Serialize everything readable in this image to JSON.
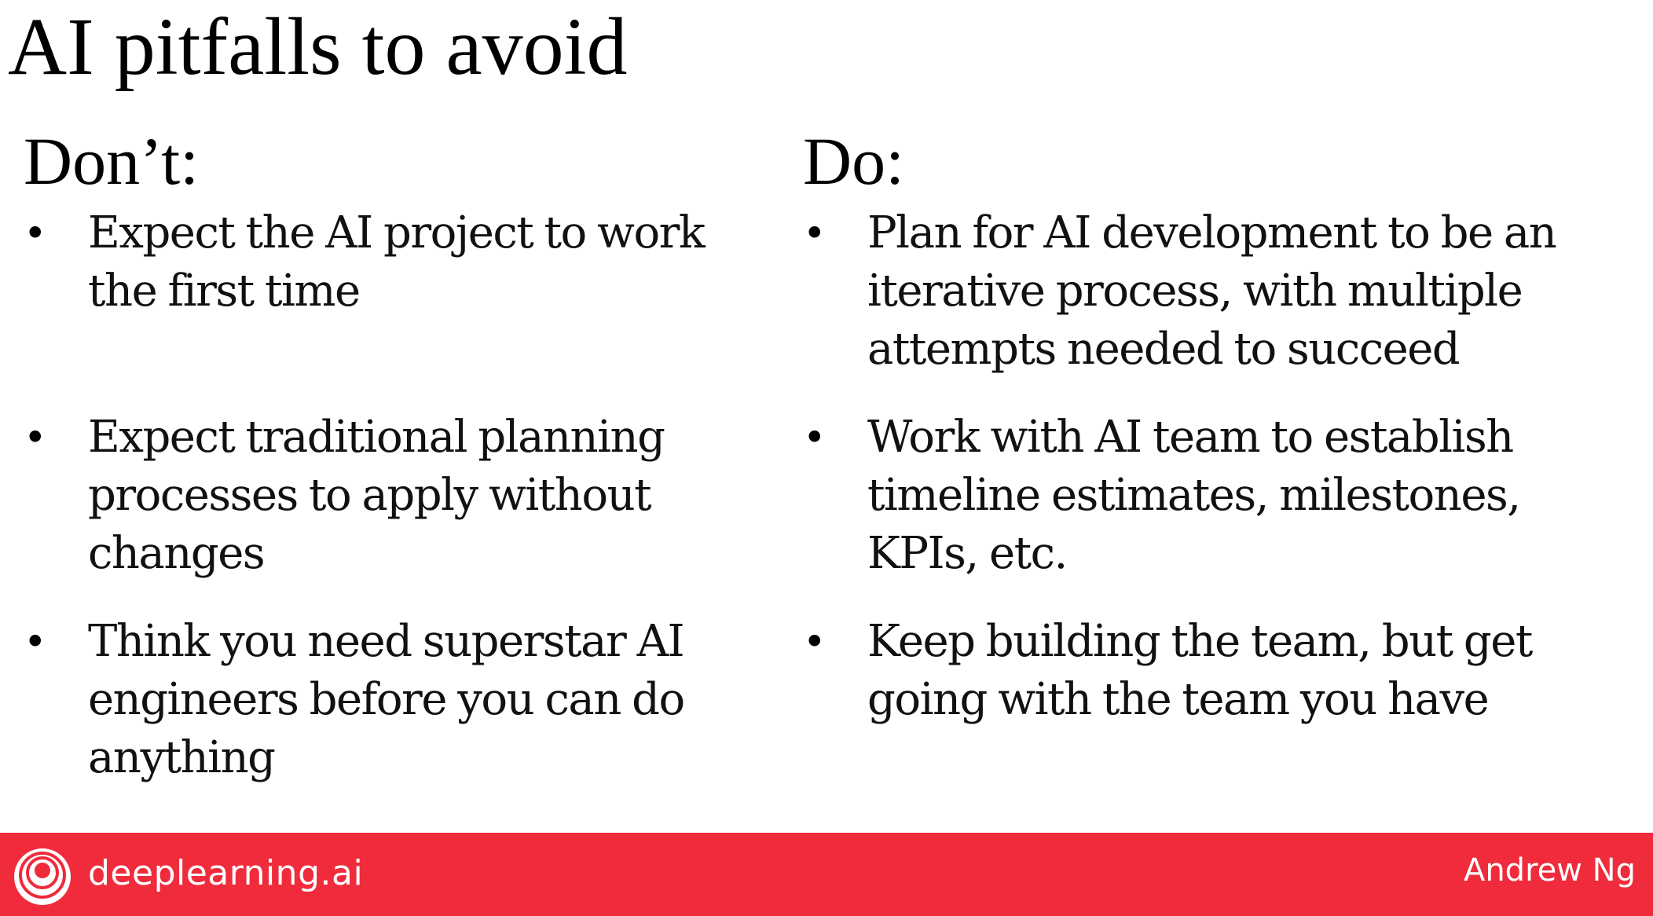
{
  "slide": {
    "title": "AI pitfalls to avoid",
    "columns": [
      {
        "heading": "Don’t:",
        "bullets": [
          "Expect the AI project to work the first time",
          "Expect traditional planning processes to apply without changes",
          "Think you need superstar AI engineers before you can do anything"
        ]
      },
      {
        "heading": "Do:",
        "bullets": [
          "Plan for AI development to be an iterative process, with multiple attempts needed to succeed",
          "Work with AI team to establish timeline estimates, milestones, KPIs, etc.",
          "Keep building the team, but get going with the team you have"
        ]
      }
    ],
    "bullet_symbol": "•"
  },
  "footer": {
    "brand": "deeplearning.ai",
    "logo_icon": "deeplearning-logo-icon",
    "author": "Andrew Ng",
    "background_color": "#ef2b3c"
  }
}
